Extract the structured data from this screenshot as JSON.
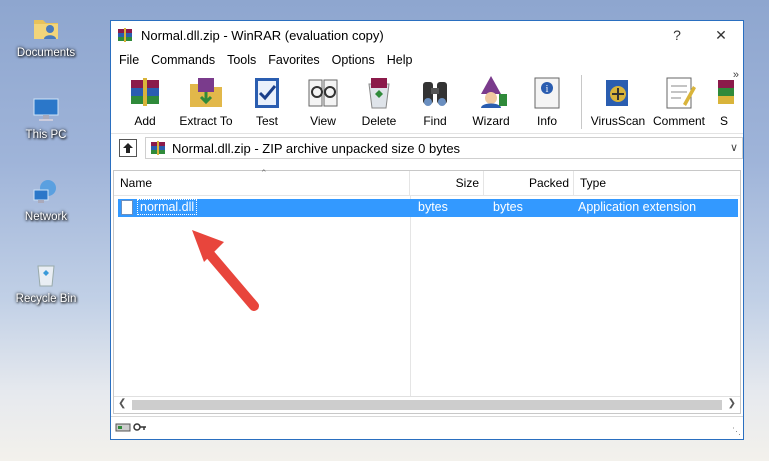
{
  "desktop": {
    "icons": [
      {
        "label": "Documents",
        "icon": "documents-user-icon"
      },
      {
        "label": "This PC",
        "icon": "computer-icon"
      },
      {
        "label": "Network",
        "icon": "network-icon"
      },
      {
        "label": "Recycle Bin",
        "icon": "recycle-bin-icon"
      }
    ]
  },
  "window": {
    "title": "Normal.dll.zip - WinRAR (evaluation copy)",
    "help_button": "?",
    "close_button": "✕"
  },
  "menu": [
    "File",
    "Commands",
    "Tools",
    "Favorites",
    "Options",
    "Help"
  ],
  "toolbar": {
    "buttons": [
      {
        "label": "Add",
        "icon": "add-books-icon"
      },
      {
        "label": "Extract To",
        "icon": "extract-folder-icon"
      },
      {
        "label": "Test",
        "icon": "test-check-icon"
      },
      {
        "label": "View",
        "icon": "view-glasses-icon"
      },
      {
        "label": "Delete",
        "icon": "delete-recycle-icon"
      },
      {
        "label": "Find",
        "icon": "find-binoculars-icon"
      },
      {
        "label": "Wizard",
        "icon": "wizard-icon"
      },
      {
        "label": "Info",
        "icon": "info-icon"
      },
      {
        "label": "VirusScan",
        "icon": "virusscan-icon"
      },
      {
        "label": "Comment",
        "icon": "comment-icon"
      },
      {
        "label": "S",
        "icon": "sfx-icon"
      }
    ],
    "overflow": "»"
  },
  "address": {
    "text": "Normal.dll.zip - ZIP archive unpacked size 0 bytes"
  },
  "columns": [
    "Name",
    "Size",
    "Packed",
    "Type"
  ],
  "rows": [
    {
      "name": "normal.dll",
      "size": "bytes",
      "packed": "bytes",
      "type": "Application extension",
      "selected": true
    }
  ],
  "colors": {
    "selection": "#3399ff",
    "annotation_arrow": "#e8453c",
    "window_border": "#2a6fc0"
  }
}
